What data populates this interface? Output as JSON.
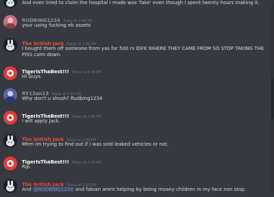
{
  "colors": {
    "bg": "#36393f",
    "text": "#dcddde",
    "muted": "#72767d",
    "mention": "#7289da"
  },
  "messages": [
    {
      "avatar": "rabbit-avatar",
      "avatar_bg": "#1d1f22",
      "author": "",
      "color": "#dcddde",
      "time": "",
      "text": "And even tried to claim the hospital i made was 'fake' even though i spent twenty hours making it."
    },
    {
      "avatar": "pink-avatar",
      "avatar_bg": "#c9707f",
      "author": "RUDBING1234",
      "color": "#8e9297",
      "time": "Today at 2:48 PM",
      "text": "your using fucking eb assets"
    },
    {
      "avatar": "rabbit-avatar",
      "avatar_bg": "#1d1f22",
      "author": "The british Jack",
      "color": "#e74c3c",
      "time": "Today at 2:48 PM",
      "text": "I bought them off someone from yas for 500 rs IDFK WHERE THEY CAME FROM SO STOP TAKING THE PISS calm down."
    },
    {
      "avatar": "red-avatar",
      "avatar_bg": "#e23c3c",
      "author": "TigerIsThaBest!!!",
      "color": "#ffffff",
      "time": "Today at 2:48 PM",
      "text": "Hi Guys."
    },
    {
      "avatar": "blue-avatar",
      "avatar_bg": "#5865a4",
      "author": "RY13an13",
      "color": "#8e9297",
      "time": "Today at 2:49 PM",
      "text": "Why don't u shush? Rudbing1234"
    },
    {
      "avatar": "red-avatar",
      "avatar_bg": "#e23c3c",
      "author": "TigerIsThaBest!!!",
      "color": "#ffffff",
      "time": "Today at 2:49 PM",
      "text": "I will apply Jack."
    },
    {
      "avatar": "rabbit-avatar",
      "avatar_bg": "#1d1f22",
      "author": "The british Jack",
      "color": "#e74c3c",
      "time": "Today at 2:49 PM",
      "text": "Mhm im trying to find out if i was sold leaked vehicles or not."
    },
    {
      "avatar": "red-avatar",
      "avatar_bg": "#e23c3c",
      "author": "TigerIsThaBest!!!",
      "color": "#ffffff",
      "time": "Today at 2:49 PM",
      "text": "Rip."
    },
    {
      "avatar": "rabbit-avatar",
      "avatar_bg": "#1d1f22",
      "author": "The british Jack",
      "color": "#e74c3c",
      "time": "Today at 2:50 PM",
      "text_before": "And ",
      "mention": "@RUDBING1234",
      "text_after": " and fabian arent helping by being moany children in my face non stop."
    }
  ]
}
